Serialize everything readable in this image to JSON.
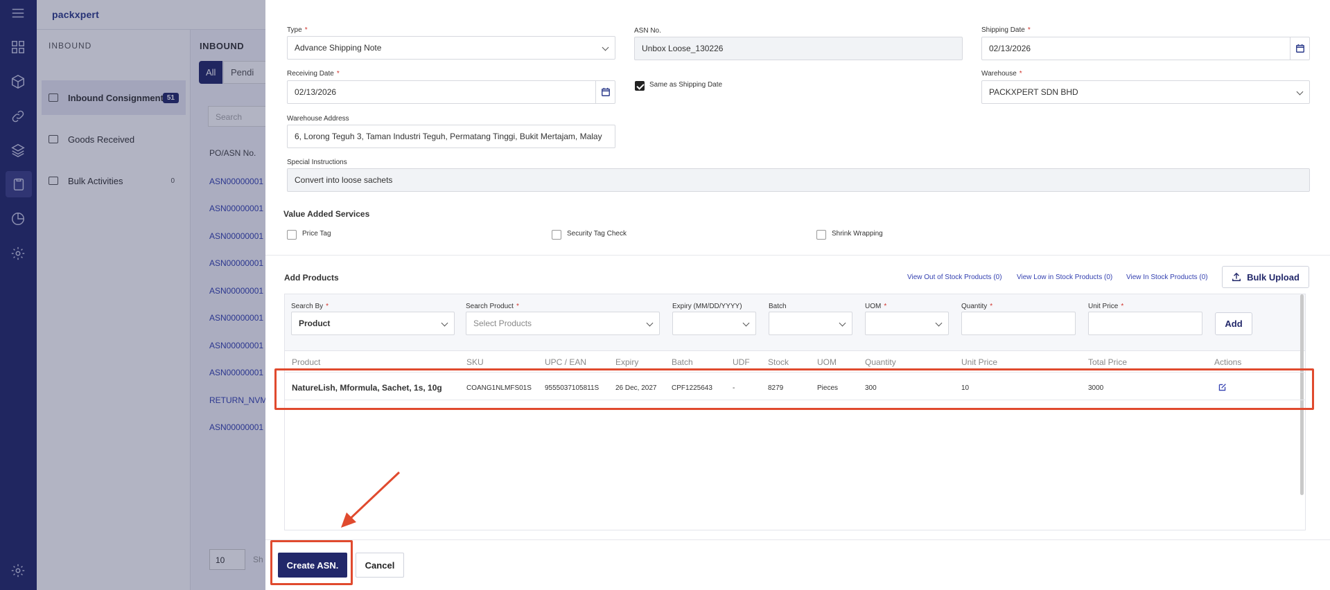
{
  "app": {
    "logo": "packxpert"
  },
  "rail": {
    "icons": [
      "menu-icon",
      "dashboard-icon",
      "box-icon",
      "link-icon",
      "layers-icon",
      "clipboard-icon",
      "chart-icon",
      "settings-icon",
      "settings-bottom-icon"
    ]
  },
  "sub_nav": {
    "header": "INBOUND",
    "items": [
      {
        "label": "Inbound Consignment",
        "count": "51"
      },
      {
        "label": "Goods Received",
        "count": ""
      },
      {
        "label": "Bulk Activities",
        "count": "0"
      }
    ]
  },
  "list": {
    "header": "INBOUND",
    "tabs": [
      "All",
      "Pendi"
    ],
    "search_placeholder": "Search",
    "column": "PO/ASN No.",
    "rows": [
      "ASN00000001",
      "ASN00000001",
      "ASN00000001",
      "ASN00000001",
      "ASN00000001",
      "ASN00000001",
      "ASN00000001",
      "ASN00000001",
      "RETURN_NVM",
      "ASN00000001"
    ],
    "page_size": "10",
    "page_size_suffix": "Sh"
  },
  "form": {
    "type": {
      "label": "Type",
      "value": "Advance Shipping Note"
    },
    "asn_no": {
      "label": "ASN No.",
      "value": "Unbox Loose_130226"
    },
    "shipping_date": {
      "label": "Shipping Date",
      "value": "02/13/2026"
    },
    "receiving_date": {
      "label": "Receiving Date",
      "value": "02/13/2026"
    },
    "same_as_shipping": {
      "label": "Same as Shipping Date",
      "checked": true
    },
    "warehouse": {
      "label": "Warehouse",
      "value": "PACKXPERT SDN BHD"
    },
    "warehouse_address": {
      "label": "Warehouse Address",
      "value": "6, Lorong Teguh 3, Taman Industri Teguh, Permatang Tinggi, Bukit Mertajam, Malay"
    },
    "special_instructions": {
      "label": "Special Instructions",
      "value": "Convert into loose sachets"
    }
  },
  "vas": {
    "title": "Value Added Services",
    "options": [
      "Price Tag",
      "Security Tag Check",
      "Shrink Wrapping"
    ]
  },
  "add_products": {
    "title": "Add Products",
    "links": [
      "View Out of Stock Products (0)",
      "View Low in Stock Products (0)",
      "View In Stock Products (0)"
    ],
    "bulk_upload": "Bulk Upload",
    "search_by": {
      "label": "Search By",
      "value": "Product"
    },
    "search_product": {
      "label": "Search Product",
      "placeholder": "Select Products"
    },
    "expiry_label": "Expiry (MM/DD/YYYY)",
    "batch_label": "Batch",
    "uom_label": "UOM",
    "quantity_label": "Quantity",
    "unit_price_label": "Unit Price",
    "add_button": "Add",
    "columns": [
      "Product",
      "SKU",
      "UPC / EAN",
      "Expiry",
      "Batch",
      "UDF",
      "Stock",
      "UOM",
      "Quantity",
      "Unit Price",
      "Total Price",
      "Actions"
    ],
    "rows": [
      {
        "product": "NatureLish, Mformula, Sachet, 1s, 10g",
        "sku": "COANG1NLMFS01S",
        "upc": "9555037105811S",
        "expiry": "26 Dec, 2027",
        "batch": "CPF1225643",
        "udf": "-",
        "stock": "8279",
        "uom": "Pieces",
        "quantity": "300",
        "unit_price": "10",
        "total_price": "3000"
      }
    ]
  },
  "footer": {
    "create": "Create ASN.",
    "cancel": "Cancel"
  },
  "colors": {
    "primary": "#22286a",
    "link": "#3340b0",
    "highlight": "#e04a2e"
  }
}
